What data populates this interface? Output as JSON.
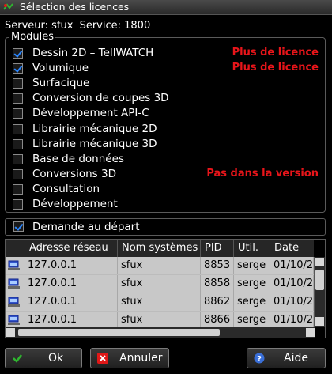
{
  "window": {
    "title": "Sélection des licences"
  },
  "server": {
    "server_text": "Serveur: sfux",
    "service_text": "Service: 1800"
  },
  "modules": {
    "group_label": "Modules",
    "items": [
      {
        "label": "Dessin 2D – TellWATCH",
        "checked": true,
        "note": "Plus de licence"
      },
      {
        "label": "Volumique",
        "checked": true,
        "note": "Plus de licence"
      },
      {
        "label": "Surfacique",
        "checked": false,
        "note": ""
      },
      {
        "label": "Conversion de coupes 3D",
        "checked": false,
        "note": ""
      },
      {
        "label": "Développement API-C",
        "checked": false,
        "note": ""
      },
      {
        "label": "Librairie mécanique 2D",
        "checked": false,
        "note": ""
      },
      {
        "label": "Librairie mécanique 3D",
        "checked": false,
        "note": ""
      },
      {
        "label": "Base de données",
        "checked": false,
        "note": ""
      },
      {
        "label": "Conversions 3D",
        "checked": false,
        "note": "Pas dans la version"
      },
      {
        "label": "Consultation",
        "checked": false,
        "note": ""
      },
      {
        "label": "Développement",
        "checked": false,
        "note": ""
      }
    ],
    "note_color": "#e8151a"
  },
  "demand": {
    "label": "Demande au départ",
    "checked": true
  },
  "table": {
    "columns": [
      "Adresse réseau",
      "Nom systèmes",
      "PID",
      "Util.",
      "Date"
    ],
    "rows": [
      [
        "127.0.0.1",
        "sfux",
        "8853",
        "serge",
        "01/10/2"
      ],
      [
        "127.0.0.1",
        "sfux",
        "8858",
        "serge",
        "01/10/2"
      ],
      [
        "127.0.0.1",
        "sfux",
        "8862",
        "serge",
        "01/10/2"
      ],
      [
        "127.0.0.1",
        "sfux",
        "8866",
        "serge",
        "01/10/2"
      ]
    ]
  },
  "buttons": {
    "ok": "Ok",
    "cancel": "Annuler",
    "help": "Aide"
  },
  "icons": {
    "ok": "check-icon",
    "cancel": "x-icon",
    "help": "help-icon",
    "row": "computer-icon",
    "app": "app-icon"
  },
  "colors": {
    "check_accent": "#2a86ff",
    "ok_icon": "#2fb52f",
    "cancel_icon": "#e01818",
    "help_icon": "#3a6fd8"
  }
}
